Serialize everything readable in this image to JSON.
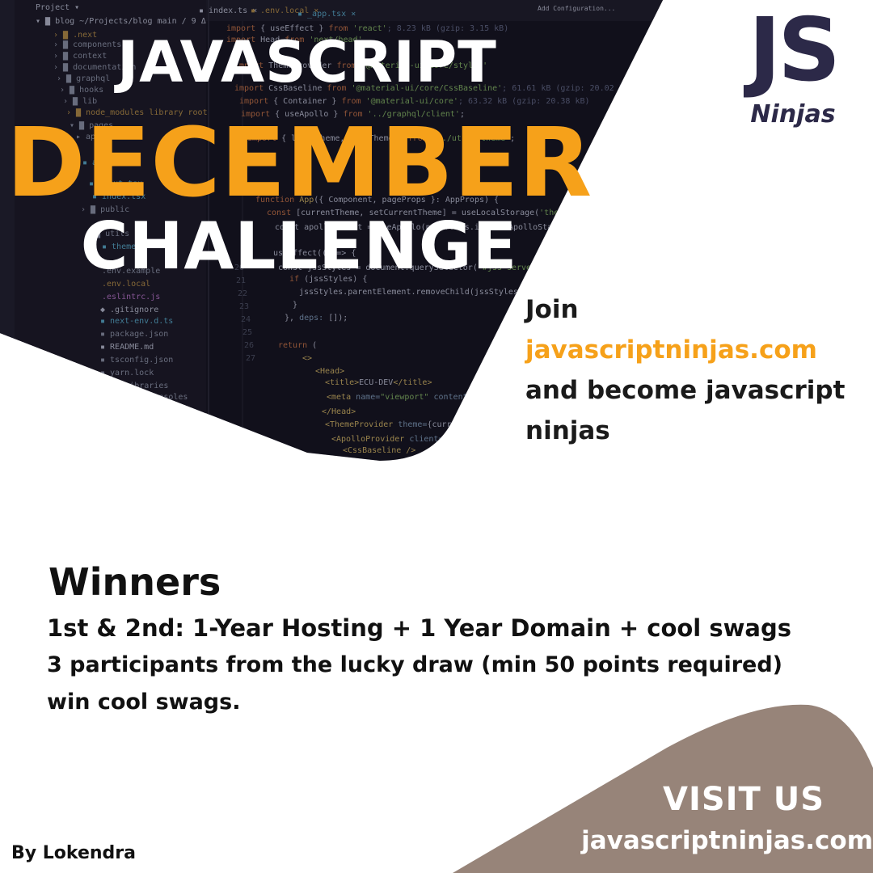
{
  "headline": {
    "line1": "JAVASCRIPT",
    "line2": "DECEMBER",
    "line3": "CHALLENGE"
  },
  "logo": {
    "mark": "JS",
    "word": "Ninjas"
  },
  "join": {
    "line1": "Join",
    "url": "javascriptninjas.com",
    "line3": "and become javascript",
    "line4": "ninjas"
  },
  "winners": {
    "title": "Winners",
    "line1": "1st & 2nd: 1-Year Hosting + 1 Year Domain + cool swags",
    "line2": "3 participants from the lucky draw (min 50 points required)",
    "line3": "win cool swags."
  },
  "visit": {
    "title": "VISIT US",
    "url": "javascriptninjas.com"
  },
  "byline": "By Lokendra",
  "colors": {
    "accent": "#f6a11a",
    "panel": "#15131f",
    "logo": "#2c2948",
    "visit_bg": "#978479"
  }
}
